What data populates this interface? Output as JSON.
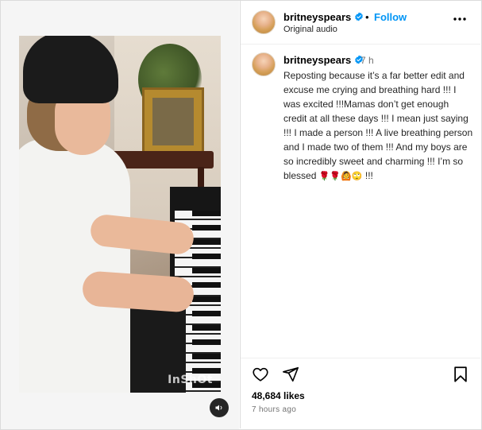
{
  "post": {
    "username": "britneyspears",
    "follow_label": "Follow",
    "dot": "•",
    "audio_label": "Original audio",
    "time_short": "7 h",
    "caption": "Reposting because it’s a far better edit and excuse me crying and breathing hard !!! I was excited !!!Mamas don’t get enough credit at all these days !!! I mean just saying !!! I made a person !!! A live breathing person and I made two of them !!! And my boys are so incredibly sweet and charming !!! I’m so blessed",
    "caption_emojis": "🌹🌹🙆🙄",
    "caption_tail": "!!!",
    "likes": "48,684 likes",
    "time_ago": "7 hours ago"
  },
  "video": {
    "watermark": "InShOt"
  },
  "icons": {
    "verified": "verified-badge-icon",
    "more": "more-options-icon",
    "like": "heart-icon",
    "share": "share-icon",
    "save": "bookmark-icon",
    "mute": "speaker-icon"
  },
  "colors": {
    "accent": "#0095f6",
    "text": "#262626",
    "secondary": "#737373",
    "border": "#dbdbdb"
  }
}
